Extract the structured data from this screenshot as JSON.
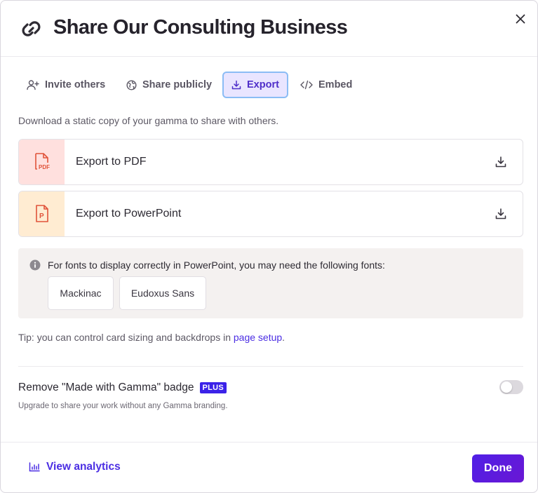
{
  "header": {
    "title": "Share Our Consulting Business",
    "title_icon": "link-icon",
    "close_icon": "close-icon"
  },
  "tabs": [
    {
      "label": "Invite others",
      "icon": "add-user-icon",
      "active": false
    },
    {
      "label": "Share publicly",
      "icon": "globe-icon",
      "active": false
    },
    {
      "label": "Export",
      "icon": "download-icon",
      "active": true
    },
    {
      "label": "Embed",
      "icon": "code-icon",
      "active": false
    }
  ],
  "description": "Download a static copy of your gamma to share with others.",
  "exports": [
    {
      "label": "Export to PDF",
      "thumb_text": "PDF",
      "thumb_bg": "#ffe0de",
      "accent": "#e0533a"
    },
    {
      "label": "Export to PowerPoint",
      "thumb_text": "P",
      "thumb_bg": "#ffecd2",
      "accent": "#e0533a"
    }
  ],
  "fonts_note": {
    "text": "For fonts to display correctly in PowerPoint, you may need the following fonts:",
    "fonts": [
      "Mackinac",
      "Eudoxus Sans"
    ]
  },
  "tip": {
    "prefix": "Tip: you can control card sizing and backdrops in ",
    "link": "page setup",
    "suffix": "."
  },
  "badge": {
    "label": "Remove \"Made with Gamma\" badge",
    "plan": "PLUS",
    "subtext": "Upgrade to share your work without any Gamma branding.",
    "enabled": false
  },
  "footer": {
    "analytics_label": "View analytics",
    "done_label": "Done"
  },
  "colors": {
    "accent": "#4b2ee3",
    "done_button": "#5a18e0",
    "active_tab_bg": "#e9e5ff",
    "active_tab_border": "#8bbcf5"
  }
}
